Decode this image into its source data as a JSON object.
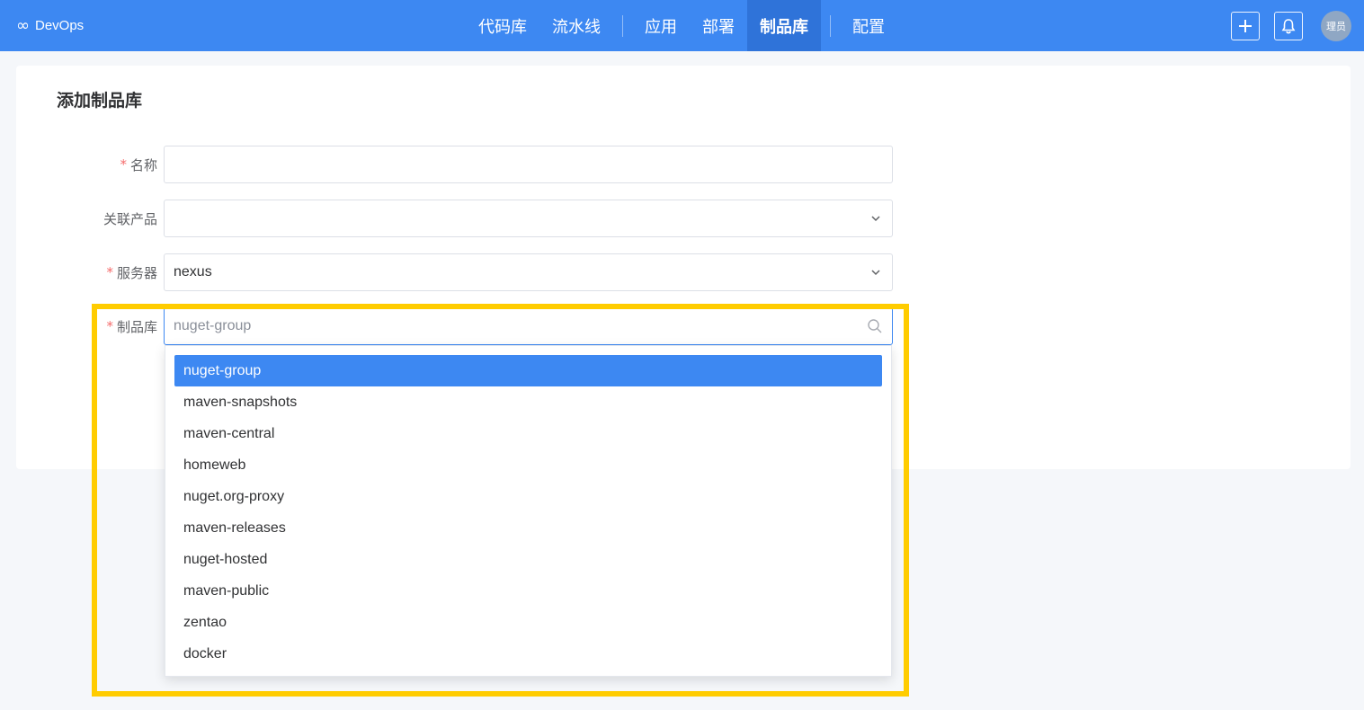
{
  "header": {
    "logo_icon": "∞",
    "logo_text": "DevOps",
    "nav": [
      {
        "label": "代码库",
        "active": false
      },
      {
        "label": "流水线",
        "active": false
      },
      {
        "label": "应用",
        "active": false
      },
      {
        "label": "部署",
        "active": false
      },
      {
        "label": "制品库",
        "active": true
      },
      {
        "label": "配置",
        "active": false
      }
    ],
    "avatar_text": "理员",
    "accent_color": "#3d88f2"
  },
  "page": {
    "title": "添加制品库"
  },
  "form": {
    "name_label": "名称",
    "name_value": "",
    "product_label": "关联产品",
    "product_value": "",
    "server_label": "服务器",
    "server_value": "nexus",
    "repo_label": "制品库",
    "repo_placeholder": "nuget-group",
    "required_mark": "*"
  },
  "dropdown": {
    "options": [
      "nuget-group",
      "maven-snapshots",
      "maven-central",
      "homeweb",
      "nuget.org-proxy",
      "maven-releases",
      "nuget-hosted",
      "maven-public",
      "zentao",
      "docker"
    ],
    "selected_index": 0
  },
  "highlight_color": "#ffcc00"
}
